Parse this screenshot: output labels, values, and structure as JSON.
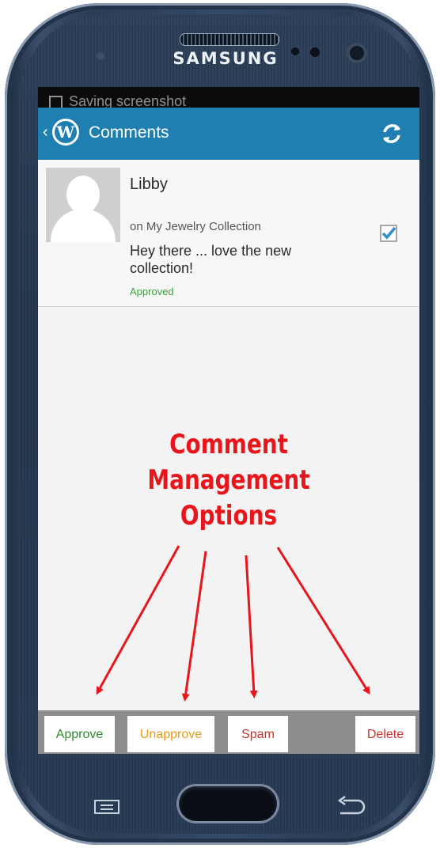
{
  "device": {
    "brand": "SAMSUNG",
    "hardware_keys": {
      "menu_icon": "menu-key-icon",
      "home": "home-button",
      "back_icon": "back-key-icon"
    }
  },
  "status_bar": {
    "notification": "Saving screenshot"
  },
  "app_bar": {
    "back_icon": "chevron-left-icon",
    "logo_icon": "wordpress-logo-icon",
    "logo_glyph": "W",
    "title": "Comments",
    "refresh_icon": "refresh-icon",
    "color": "#1f7fb0"
  },
  "comment": {
    "author": "Libby",
    "post": "on My Jewelry Collection",
    "text": "Hey there  ... love the new collection!",
    "status": "Approved",
    "status_color": "#3aa03a",
    "checked": true
  },
  "annotation": {
    "lines": [
      "Comment",
      "Management",
      "Options"
    ],
    "color": "#e8151b"
  },
  "actions": {
    "approve": "Approve",
    "unapprove": "Unapprove",
    "spam": "Spam",
    "delete": "Delete",
    "colors": {
      "approve": "#2e8b2e",
      "unapprove": "#e59a1a",
      "spam": "#c7352b",
      "delete": "#c7352b"
    }
  }
}
